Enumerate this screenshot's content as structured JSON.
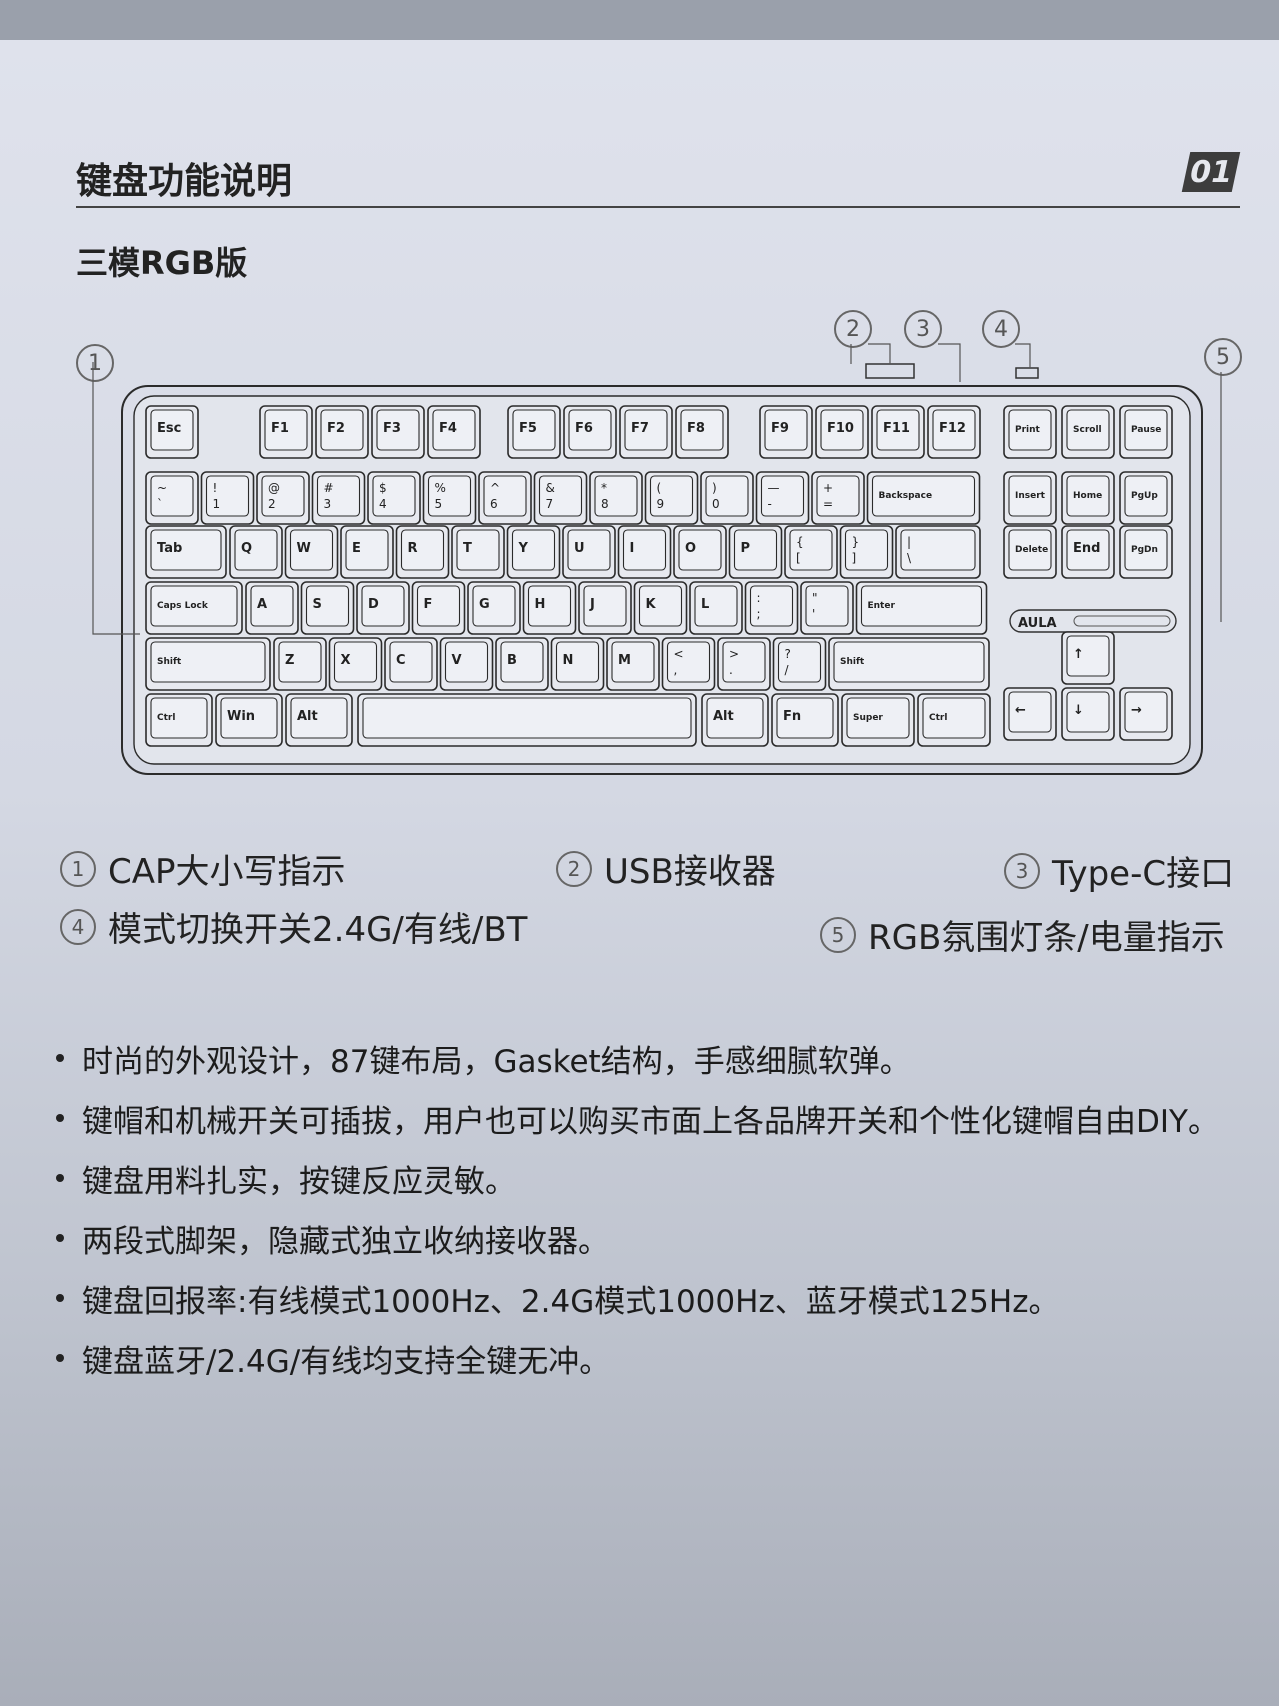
{
  "header": {
    "title": "键盘功能说明",
    "page_number": "01"
  },
  "subtitle": "三模RGB版",
  "callouts": [
    "1",
    "2",
    "3",
    "4",
    "5"
  ],
  "brand": "AULA",
  "keyboard": {
    "rows": [
      [
        "Esc",
        "F1",
        "F2",
        "F3",
        "F4",
        "F5",
        "F6",
        "F7",
        "F8",
        "F9",
        "F10",
        "F11",
        "F12",
        "Print",
        "Scroll",
        "Pause"
      ],
      [
        "~ `",
        "! 1",
        "@ 2",
        "# 3",
        "$ 4",
        "% 5",
        "^ 6",
        "& 7",
        "* 8",
        "( 9",
        ") 0",
        "— -",
        "+ =",
        "Backspace",
        "Insert",
        "Home",
        "PgUp"
      ],
      [
        "Tab",
        "Q",
        "W",
        "E",
        "R",
        "T",
        "Y",
        "U",
        "I",
        "O",
        "P",
        "{ [",
        "} ]",
        "| \\",
        "Delete",
        "End",
        "PgDn"
      ],
      [
        "Caps Lock",
        "A",
        "S",
        "D",
        "F",
        "G",
        "H",
        "J",
        "K",
        "L",
        ": ;",
        "\" '",
        "Enter"
      ],
      [
        "Shift",
        "Z",
        "X",
        "C",
        "V",
        "B",
        "N",
        "M",
        "< ,",
        "> .",
        "? /",
        "Shift",
        "↑"
      ],
      [
        "Ctrl",
        "Win",
        "Alt",
        "",
        "Alt",
        "Fn",
        "Super",
        "Ctrl",
        "←",
        "↓",
        "→"
      ]
    ]
  },
  "legend": [
    {
      "num": "1",
      "text": "CAP大小写指示"
    },
    {
      "num": "2",
      "text": "USB接收器"
    },
    {
      "num": "3",
      "text": "Type-C接口"
    },
    {
      "num": "4",
      "text": "模式切换开关2.4G/有线/BT"
    },
    {
      "num": "5",
      "text": "RGB氛围灯条/电量指示"
    }
  ],
  "features": [
    "时尚的外观设计，87键布局，Gasket结构，手感细腻软弹。",
    "键帽和机械开关可插拔，用户也可以购买市面上各品牌开关和个性化键帽自由DIY。",
    "键盘用料扎实，按键反应灵敏。",
    "两段式脚架，隐藏式独立收纳接收器。",
    "键盘回报率:有线模式1000Hz、2.4G模式1000Hz、蓝牙模式125Hz。",
    "键盘蓝牙/2.4G/有线均支持全键无冲。"
  ]
}
